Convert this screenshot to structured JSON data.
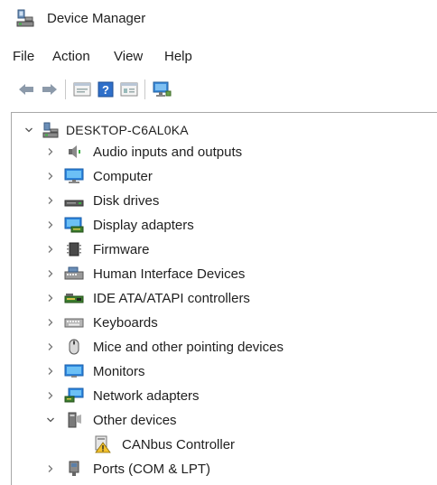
{
  "window": {
    "title": "Device Manager"
  },
  "menu": [
    "File",
    "Action",
    "View",
    "Help"
  ],
  "toolbar": {
    "buttons": [
      "back-icon",
      "forward-icon",
      "properties-icon",
      "help-icon",
      "view-icon",
      "monitor-icon"
    ]
  },
  "tree": {
    "root": {
      "label": "DESKTOP-C6AL0KA",
      "expanded": true
    },
    "items": [
      {
        "label": "Audio inputs and outputs",
        "icon": "speaker-icon",
        "expanded": false
      },
      {
        "label": "Computer",
        "icon": "computer-icon",
        "expanded": false
      },
      {
        "label": "Disk drives",
        "icon": "disk-drive-icon",
        "expanded": false
      },
      {
        "label": "Display adapters",
        "icon": "display-adapter-icon",
        "expanded": false
      },
      {
        "label": "Firmware",
        "icon": "firmware-icon",
        "expanded": false
      },
      {
        "label": "Human Interface Devices",
        "icon": "hid-icon",
        "expanded": false
      },
      {
        "label": "IDE ATA/ATAPI controllers",
        "icon": "ide-controller-icon",
        "expanded": false
      },
      {
        "label": "Keyboards",
        "icon": "keyboard-icon",
        "expanded": false
      },
      {
        "label": "Mice and other pointing devices",
        "icon": "mouse-icon",
        "expanded": false
      },
      {
        "label": "Monitors",
        "icon": "monitor-icon",
        "expanded": false
      },
      {
        "label": "Network adapters",
        "icon": "network-adapter-icon",
        "expanded": false
      },
      {
        "label": "Other devices",
        "icon": "other-devices-icon",
        "expanded": true,
        "children": [
          {
            "label": "CANbus Controller",
            "icon": "unknown-device-warning-icon"
          }
        ]
      },
      {
        "label": "Ports (COM & LPT)",
        "icon": "port-icon",
        "expanded": false
      }
    ]
  }
}
